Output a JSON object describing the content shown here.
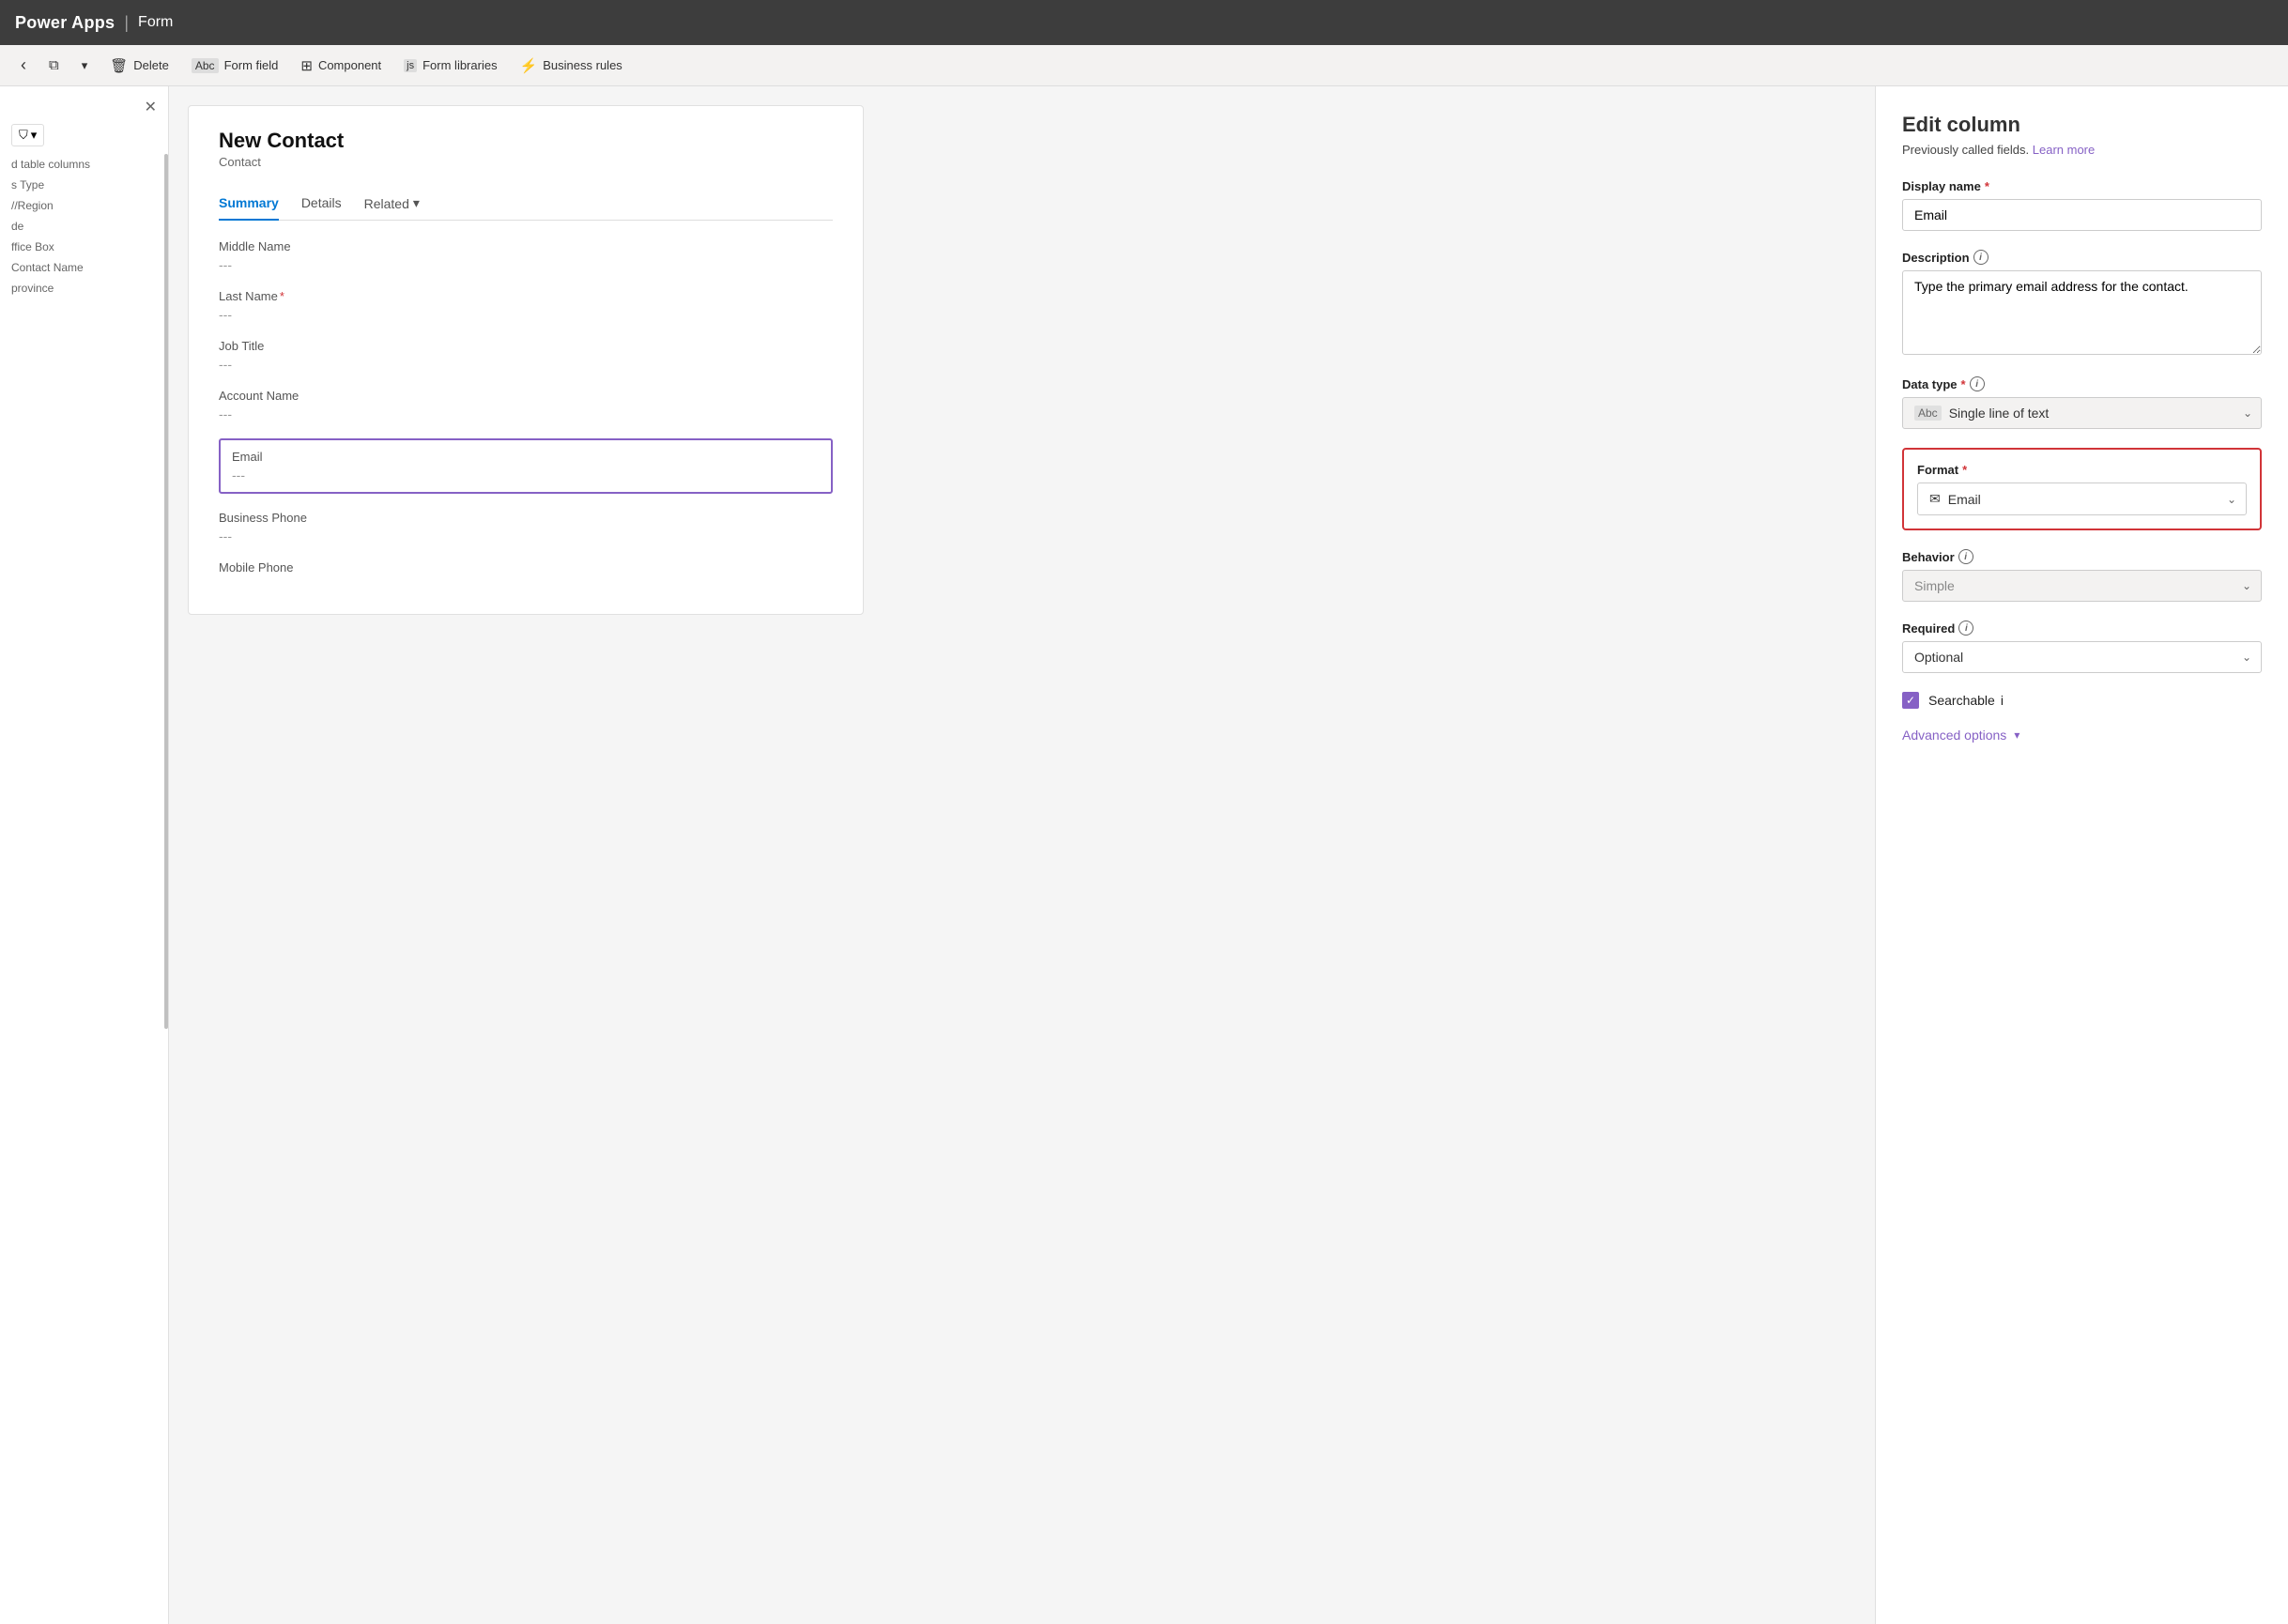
{
  "topbar": {
    "app": "Power Apps",
    "separator": "|",
    "section": "Form"
  },
  "toolbar": {
    "back_icon": "‹",
    "copy_icon": "⧉",
    "dropdown_icon": "▾",
    "delete_label": "Delete",
    "delete_icon": "🗑",
    "formfield_label": "Form field",
    "formfield_icon": "Abc",
    "component_label": "Component",
    "component_icon": "⊞",
    "formlibraries_label": "Form libraries",
    "formlibraries_icon": "js",
    "businessrules_label": "Business rules",
    "businessrules_icon": "⚡"
  },
  "sidebar": {
    "close_icon": "✕",
    "filter_icon": "⛉",
    "filter_dropdown_icon": "▾",
    "section1": "d table columns",
    "section2": "s Type",
    "section3": "//Region",
    "section4": "",
    "section5": "de",
    "section6": "",
    "section7": "ffice Box",
    "section8": "Contact Name",
    "section9": "province"
  },
  "form": {
    "title": "New Contact",
    "subtitle": "Contact",
    "tabs": [
      {
        "label": "Summary",
        "active": true
      },
      {
        "label": "Details",
        "active": false
      },
      {
        "label": "Related",
        "active": false,
        "has_dropdown": true
      }
    ],
    "fields": [
      {
        "label": "Middle Name",
        "value": "---"
      },
      {
        "label": "Last Name",
        "required": true,
        "value": "---"
      },
      {
        "label": "Job Title",
        "value": "---"
      },
      {
        "label": "Account Name",
        "value": "---"
      },
      {
        "label": "Email",
        "value": "---",
        "highlighted": true
      },
      {
        "label": "Business Phone",
        "value": "---"
      },
      {
        "label": "Mobile Phone",
        "value": ""
      }
    ]
  },
  "edit_panel": {
    "title": "Edit column",
    "subtitle": "Previously called fields.",
    "learn_more": "Learn more",
    "display_name_label": "Display name",
    "display_name_required": true,
    "display_name_value": "Email",
    "description_label": "Description",
    "description_info": true,
    "description_value": "Type the primary email address for the contact.",
    "data_type_label": "Data type",
    "data_type_required": true,
    "data_type_info": true,
    "data_type_icon": "Abc",
    "data_type_value": "Single line of text",
    "format_label": "Format",
    "format_required": true,
    "format_icon": "✉",
    "format_value": "Email",
    "behavior_label": "Behavior",
    "behavior_info": true,
    "behavior_value": "Simple",
    "required_label": "Required",
    "required_info": true,
    "required_value": "Optional",
    "searchable_label": "Searchable",
    "searchable_info": true,
    "searchable_checked": true,
    "advanced_options_label": "Advanced options",
    "advanced_options_icon": "▾",
    "chevron_down": "⌄"
  }
}
